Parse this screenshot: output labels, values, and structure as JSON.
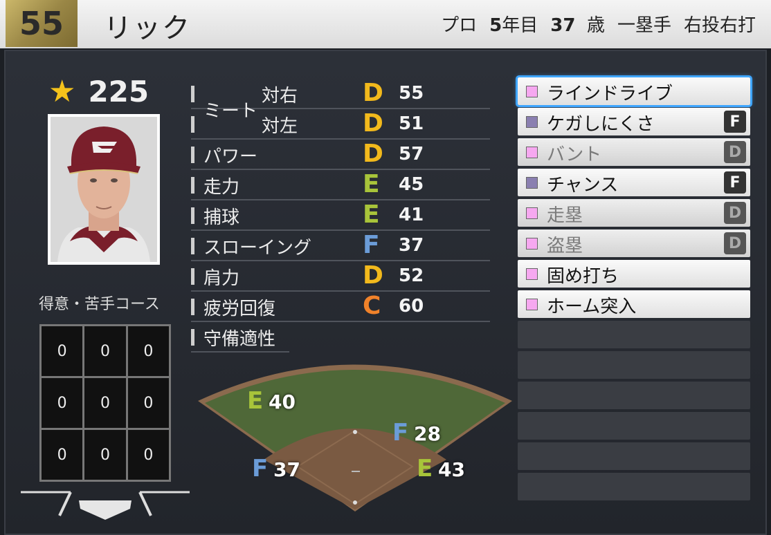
{
  "header": {
    "number": "55",
    "name": "リック",
    "status": "プロ",
    "years_num": "5",
    "years_unit": "年目",
    "age_num": "37",
    "age_unit": "歳",
    "position": "一塁手",
    "bats_throws": "右投右打"
  },
  "player": {
    "rating": "225"
  },
  "course": {
    "title": "得意・苦手コース",
    "cells": [
      "0",
      "0",
      "0",
      "0",
      "0",
      "0",
      "0",
      "0",
      "0"
    ]
  },
  "stats": {
    "meet_label": "ミート",
    "rows": [
      {
        "label": "",
        "sub": "対右",
        "grade": "D",
        "value": "55",
        "color": "#f2b91c"
      },
      {
        "label": "",
        "sub": "対左",
        "grade": "D",
        "value": "51",
        "color": "#f2b91c"
      },
      {
        "label": "パワー",
        "sub": "",
        "grade": "D",
        "value": "57",
        "color": "#f2b91c"
      },
      {
        "label": "走力",
        "sub": "",
        "grade": "E",
        "value": "45",
        "color": "#a8c43a"
      },
      {
        "label": "捕球",
        "sub": "",
        "grade": "E",
        "value": "41",
        "color": "#a8c43a"
      },
      {
        "label": "スローイング",
        "sub": "",
        "grade": "F",
        "value": "37",
        "color": "#6b9cd8"
      },
      {
        "label": "肩力",
        "sub": "",
        "grade": "D",
        "value": "52",
        "color": "#f2b91c"
      },
      {
        "label": "疲労回復",
        "sub": "",
        "grade": "C",
        "value": "60",
        "color": "#f0822a"
      },
      {
        "label": "守備適性",
        "sub": "",
        "grade": "",
        "value": "",
        "color": "#ffffff"
      }
    ]
  },
  "defense": {
    "lf": {
      "grade": "E",
      "value": "40",
      "color": "#a8c43a"
    },
    "ss": {
      "grade": "F",
      "value": "28",
      "color": "#6b9cd8"
    },
    "third": {
      "grade": "F",
      "value": "37",
      "color": "#6b9cd8"
    },
    "first": {
      "grade": "E",
      "value": "43",
      "color": "#a8c43a"
    }
  },
  "skills": [
    {
      "name": "ラインドライブ",
      "grade": "",
      "dim": false,
      "selected": true,
      "sq": "#f6a8f0"
    },
    {
      "name": "ケガしにくさ",
      "grade": "F",
      "dim": false,
      "selected": false,
      "sq": "#8a7fb0"
    },
    {
      "name": "バント",
      "grade": "D",
      "dim": true,
      "selected": false,
      "sq": "#f6a8f0"
    },
    {
      "name": "チャンス",
      "grade": "F",
      "dim": false,
      "selected": false,
      "sq": "#8a7fb0"
    },
    {
      "name": "走塁",
      "grade": "D",
      "dim": true,
      "selected": false,
      "sq": "#f6a8f0"
    },
    {
      "name": "盗塁",
      "grade": "D",
      "dim": true,
      "selected": false,
      "sq": "#f6a8f0"
    },
    {
      "name": "固め打ち",
      "grade": "",
      "dim": false,
      "selected": false,
      "sq": "#f6a8f0"
    },
    {
      "name": "ホーム突入",
      "grade": "",
      "dim": false,
      "selected": false,
      "sq": "#f6a8f0"
    }
  ],
  "colors": {
    "gold": "#b19b52",
    "selection": "#3fa6ff",
    "panel": "#2a2d33"
  }
}
